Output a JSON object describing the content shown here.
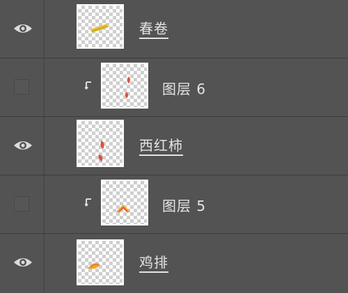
{
  "layers": [
    {
      "name": "春卷"
    },
    {
      "name": "图层 6"
    },
    {
      "name": "西红柿"
    },
    {
      "name": "图层 5"
    },
    {
      "name": "鸡排"
    }
  ],
  "colors": {
    "panel_bg": "#535353",
    "text": "#e4e4e4",
    "thumb_yellow": "#e8c23a",
    "thumb_red": "#e0503a",
    "thumb_orange": "#f0a53a"
  }
}
